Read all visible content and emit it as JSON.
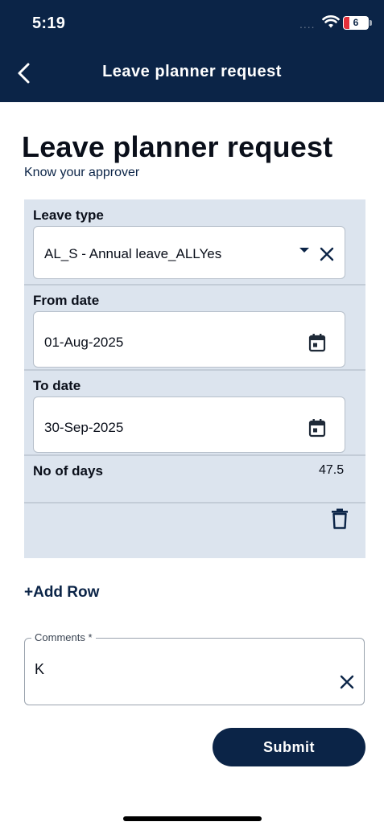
{
  "status_bar": {
    "time": "5:19",
    "signal": "....",
    "battery_level": "6",
    "icons": [
      "wifi-icon",
      "battery-icon"
    ]
  },
  "nav": {
    "back_icon": "chevron-left-icon",
    "title": "Leave planner request"
  },
  "page": {
    "title": "Leave planner request",
    "approver_link": "Know your approver"
  },
  "form": {
    "leave_type": {
      "label": "Leave type",
      "value": "AL_S - Annual leave_ALLYes",
      "icons": [
        "dropdown-arrow-icon",
        "clear-icon"
      ]
    },
    "from_date": {
      "label": "From date",
      "value": "01-Aug-2025",
      "icon": "calendar-icon"
    },
    "to_date": {
      "label": "To date",
      "value": "30-Sep-2025",
      "icon": "calendar-icon"
    },
    "no_of_days": {
      "label": "No of days",
      "value": "47.5"
    },
    "delete_icon": "trash-icon"
  },
  "add_row_label": "+Add Row",
  "comments": {
    "label": "Comments *",
    "value": "K",
    "clear_icon": "clear-icon"
  },
  "submit_label": "Submit",
  "colors": {
    "header_bg": "#0b2447",
    "panel_bg": "#dce4ee",
    "accent": "#0b2447",
    "battery_low": "#e5303a"
  }
}
